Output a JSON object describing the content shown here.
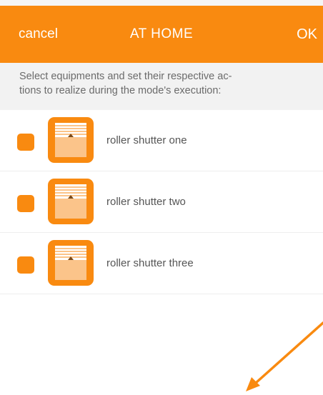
{
  "header": {
    "cancel_label": "cancel",
    "title": "AT HOME",
    "ok_label": "OK"
  },
  "instructions": {
    "line1": "Select equipments and set their respective ac-",
    "line2": "tions to realize during the mode's execution:"
  },
  "equipment": [
    {
      "label": "roller shutter one",
      "icon": "roller-shutter-icon",
      "checked": false
    },
    {
      "label": "roller shutter two",
      "icon": "roller-shutter-icon",
      "checked": false
    },
    {
      "label": "roller shutter three",
      "icon": "roller-shutter-icon",
      "checked": false
    }
  ],
  "colors": {
    "accent": "#f98a10",
    "instruction_bg": "#f2f2f2",
    "text": "#555555"
  }
}
